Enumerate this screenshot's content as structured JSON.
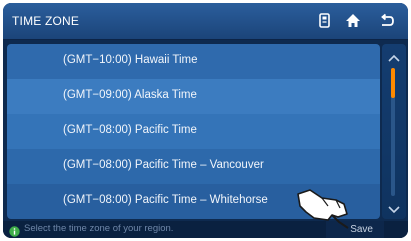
{
  "header": {
    "title": "TIME ZONE",
    "icons": [
      "device-icon",
      "home-icon",
      "back-icon"
    ]
  },
  "timezones": [
    {
      "label": "(GMT−10:00) Hawaii Time",
      "color": "#2f6aad"
    },
    {
      "label": "(GMT−09:00) Alaska Time",
      "color": "#3c7cc0"
    },
    {
      "label": "(GMT−08:00) Pacific Time",
      "color": "#3474b8"
    },
    {
      "label": "(GMT−08:00) Pacific Time – Vancouver",
      "color": "#2d69ab"
    },
    {
      "label": "(GMT−08:00) Pacific Time – Whitehorse",
      "color": "#285f9f"
    }
  ],
  "scrollbar": {
    "accent": "#ff8a00",
    "position": 0
  },
  "footer": {
    "hint": "Select the time zone of your region.",
    "save_label": "Save",
    "info_color": "#3fae49"
  }
}
